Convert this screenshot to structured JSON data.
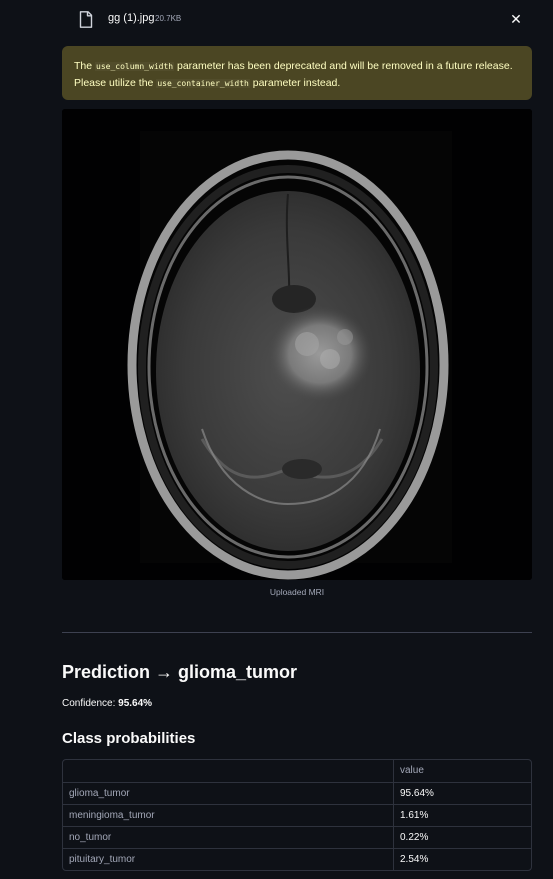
{
  "file": {
    "name": "gg (1).jpg",
    "size": "20.7KB"
  },
  "alert": {
    "part1": "The ",
    "code1": "use_column_width",
    "part2": " parameter has been deprecated and will be removed in a future release. Please utilize the ",
    "code2": "use_container_width",
    "part3": " parameter instead."
  },
  "image": {
    "caption": "Uploaded MRI"
  },
  "prediction": {
    "title": "Prediction → glioma_tumor",
    "confidence_label": "Confidence: ",
    "confidence_value": "95.64%"
  },
  "probabilities": {
    "title": "Class probabilities",
    "column_header": "value",
    "rows": [
      {
        "label": "glioma_tumor",
        "value": "95.64%"
      },
      {
        "label": "meningioma_tumor",
        "value": "1.61%"
      },
      {
        "label": "no_tumor",
        "value": "0.22%"
      },
      {
        "label": "pituitary_tumor",
        "value": "2.54%"
      }
    ]
  },
  "colors": {
    "background": "#0e1117",
    "alert_background": "#4b4623",
    "alert_text": "#ffffc2"
  }
}
